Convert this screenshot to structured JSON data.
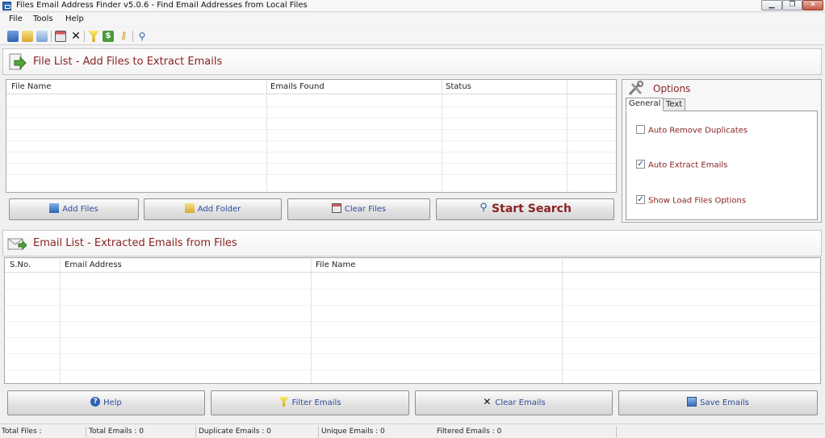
{
  "window": {
    "title": "Files Email Address Finder v5.0.6 -  Find Email Addresses from Local Files",
    "min_glyph": "▁",
    "max_glyph": "❐",
    "close_glyph": "✕"
  },
  "menu": [
    "File",
    "Tools",
    "Help"
  ],
  "toolbar": {
    "icons": [
      "add-files-icon",
      "add-folder-icon",
      "copy-icon",
      "window-icon",
      "delete-icon",
      "filter-icon",
      "money-icon",
      "key-icon",
      "search-icon"
    ]
  },
  "file_list": {
    "title": "File List - Add Files to Extract Emails",
    "columns": [
      "File Name",
      "Emails Found",
      "Status"
    ]
  },
  "file_buttons": {
    "add_files": "Add Files",
    "add_folder": "Add Folder",
    "clear_files": "Clear Files",
    "start_search": "Start Search"
  },
  "options": {
    "title": "Options",
    "tabs": [
      "General",
      "Text"
    ],
    "items": [
      {
        "label": "Auto Remove Duplicates",
        "checked": false
      },
      {
        "label": "Auto Extract Emails",
        "checked": true
      },
      {
        "label": "Show Load Files Options",
        "checked": true
      }
    ]
  },
  "email_list": {
    "title": "Email List - Extracted Emails from Files",
    "columns": [
      "S.No.",
      "Email Address",
      "File Name"
    ]
  },
  "bottom_buttons": {
    "help": "Help",
    "filter_emails": "Filter Emails",
    "clear_emails": "Clear Emails",
    "save_emails": "Save Emails"
  },
  "status": {
    "total_files": "Total Files :",
    "total_emails": "Total Emails :  0",
    "duplicate_emails": "Duplicate Emails :  0",
    "unique_emails": "Unique Emails :  0",
    "filtered_emails": "Filtered Emails :  0"
  },
  "colors": {
    "title_red": "#8a2323",
    "button_blue": "#2f4c9a"
  }
}
